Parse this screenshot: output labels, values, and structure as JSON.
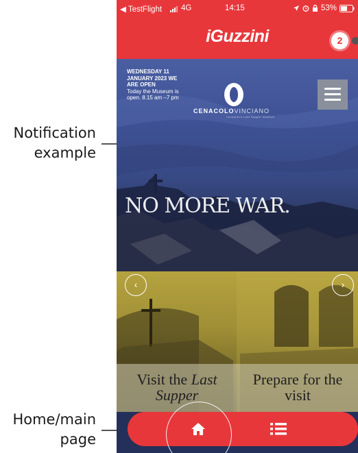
{
  "annotations": {
    "notification": [
      "Notification",
      "example"
    ],
    "home": [
      "Home/main",
      "page"
    ]
  },
  "status_bar": {
    "back_label": "◀ TestFlight",
    "network": "4G",
    "time": "14:15",
    "battery": "53%"
  },
  "app_header": {
    "logo": "iGuzzini",
    "notification_count": "2"
  },
  "hero": {
    "date_heading_1": "WEDNESDAY 11",
    "date_heading_2": "JANUARY 2023 WE",
    "date_heading_3": "ARE OPEN",
    "hours_1": "Today the Museum is",
    "hours_2": "open. 8.15 am –7 pm",
    "museum_name_bold": "CENACOLO",
    "museum_name_light": "VINCIANO",
    "museum_tagline": "Leonardo's Last Supper museum",
    "headline": "NO MORE WAR."
  },
  "cards": [
    {
      "line1": "Visit the",
      "line1_italic": "Last",
      "line2": "Supper"
    },
    {
      "line1": "Prepare for the",
      "line2": "visit"
    }
  ],
  "bottom_nav": {
    "home_icon": "home-icon",
    "list_icon": "list-icon"
  },
  "colors": {
    "brand_red": "#e8373b",
    "hero_blue": "#3e5194",
    "hero_yellow": "#b8a640"
  }
}
